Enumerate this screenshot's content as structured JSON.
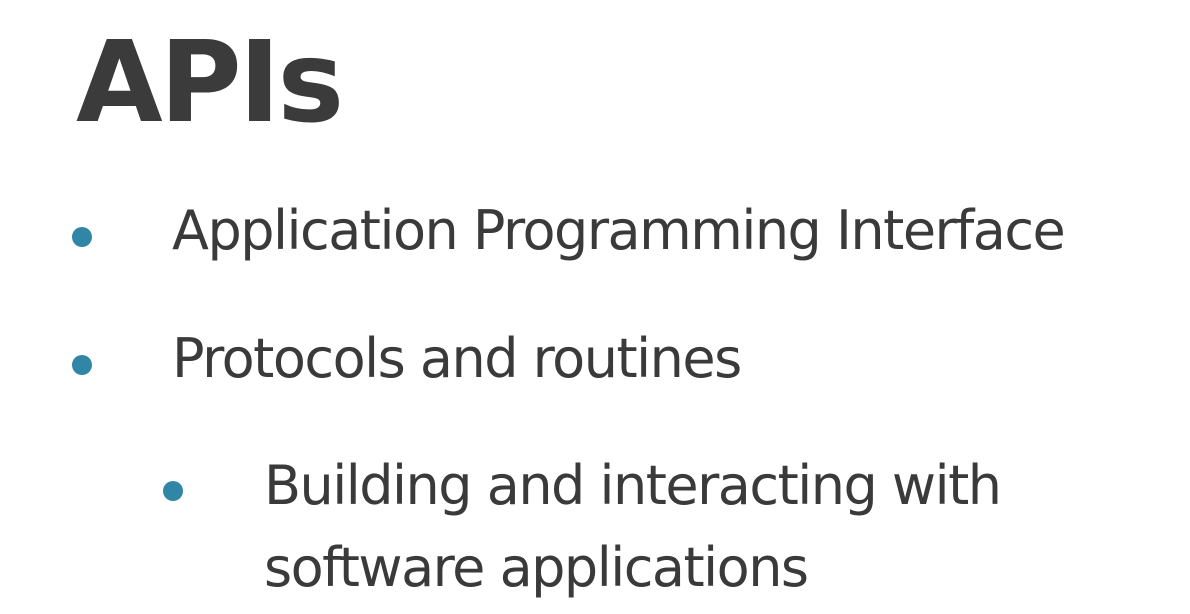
{
  "slide": {
    "title": "APIs",
    "bullets": [
      {
        "text": "Application Programming Interface",
        "level": 1
      },
      {
        "text": "Protocols and routines",
        "level": 1
      },
      {
        "text": "Building and interacting with software applications",
        "level": 2
      }
    ]
  },
  "colors": {
    "text": "#3a3a3a",
    "bullet": "#2f86a6",
    "background": "#ffffff"
  }
}
